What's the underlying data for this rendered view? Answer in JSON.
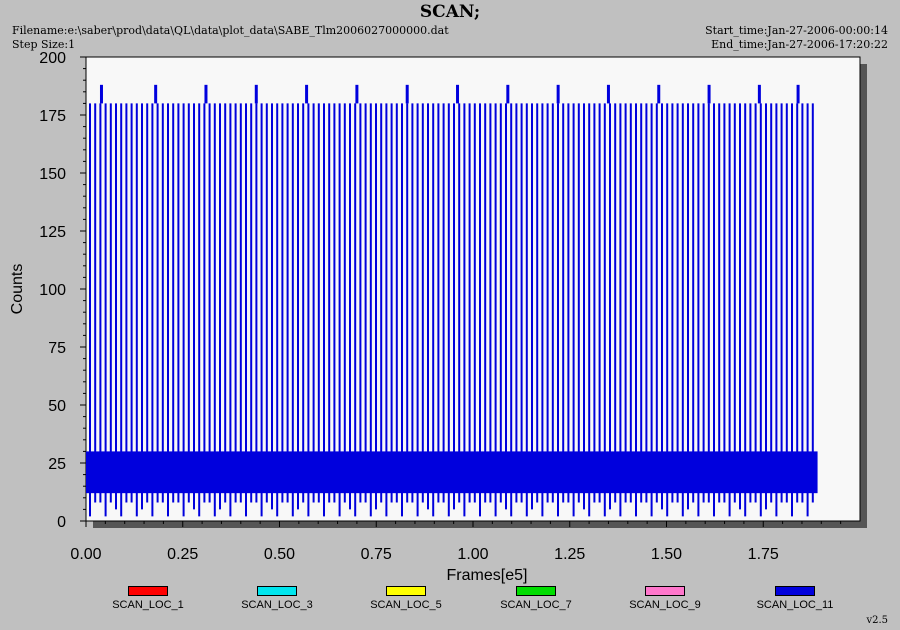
{
  "header": {
    "title": "SCAN;",
    "filename": "Filename:e:\\saber\\prod\\data\\QL\\data\\plot_data\\SABE_Tlm2006027000000.dat",
    "step_size": "Step Size:1",
    "start_time": "Start_time:Jan-27-2006-00:00:14",
    "end_time": "End_time:Jan-27-2006-17:20:22"
  },
  "version": "v2.5",
  "chart_data": {
    "type": "line",
    "title": "SCAN;",
    "xlabel": "Frames[e5]",
    "ylabel": "Counts",
    "xlim": [
      0,
      2.0
    ],
    "ylim": [
      0,
      200
    ],
    "x_ticks": [
      "0.00",
      "0.25",
      "0.50",
      "0.75",
      "1.00",
      "1.25",
      "1.50",
      "1.75"
    ],
    "y_ticks": [
      "0",
      "25",
      "50",
      "75",
      "100",
      "125",
      "150",
      "175",
      "200"
    ],
    "grid": false,
    "legend_position": "bottom",
    "series": [
      {
        "name": "SCAN_LOC_1",
        "color": "#ff0000",
        "values": []
      },
      {
        "name": "SCAN_LOC_3",
        "color": "#00e5ee",
        "values": []
      },
      {
        "name": "SCAN_LOC_5",
        "color": "#ffff00",
        "values": []
      },
      {
        "name": "SCAN_LOC_7",
        "color": "#00dd00",
        "values": []
      },
      {
        "name": "SCAN_LOC_9",
        "color": "#ff77cc",
        "values": []
      },
      {
        "name": "SCAN_LOC_11",
        "color": "#0000dd",
        "summary": {
          "x_end": 1.88,
          "baseline_range": [
            10,
            30
          ],
          "scan_peak": 180,
          "tall_peak": 188,
          "min": 2
        },
        "tall_peak_x": [
          0.04,
          0.18,
          0.31,
          0.44,
          0.57,
          0.7,
          0.83,
          0.96,
          1.09,
          1.22,
          1.35,
          1.48,
          1.61,
          1.74,
          1.84
        ]
      }
    ]
  }
}
